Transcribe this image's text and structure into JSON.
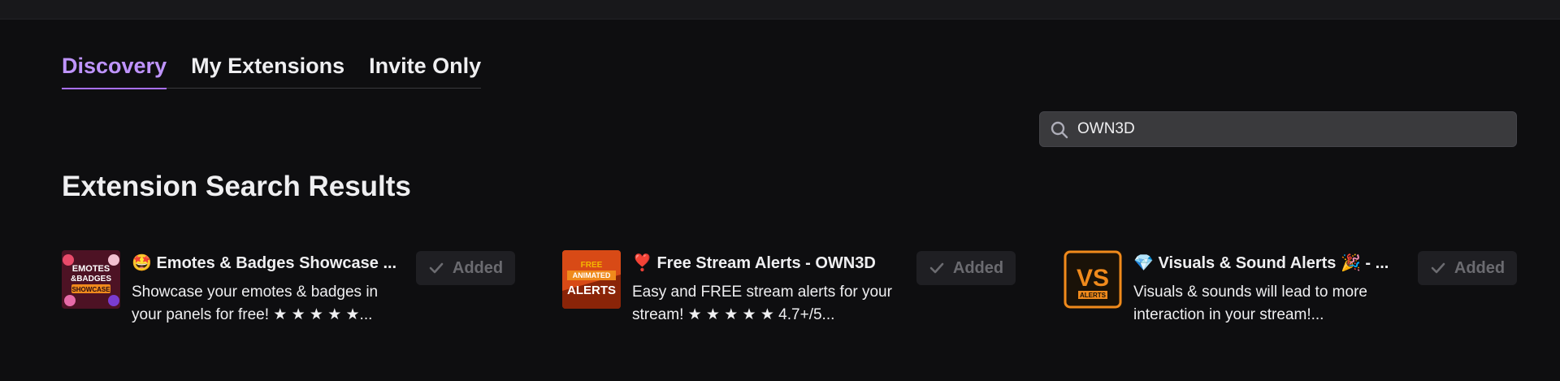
{
  "tabs": [
    {
      "label": "Discovery",
      "active": true
    },
    {
      "label": "My Extensions",
      "active": false
    },
    {
      "label": "Invite Only",
      "active": false
    }
  ],
  "search": {
    "value": "OWN3D",
    "icon": "search-icon"
  },
  "heading": "Extension Search Results",
  "results": [
    {
      "title": "🤩 Emotes & Badges Showcase ...",
      "description": "Showcase your emotes & badges in your panels for free! ★ ★ ★ ★ ★...",
      "button_label": "Added",
      "thumbnail_text": [
        "EMOTES",
        "&BADGES",
        "SHOWCASE"
      ]
    },
    {
      "title": "❣️ Free Stream Alerts - OWN3D",
      "description": "Easy and FREE stream alerts for your stream! ★ ★ ★ ★ ★ 4.7+/5...",
      "button_label": "Added",
      "thumbnail_text": [
        "FREE",
        "ANIMATED",
        "ALERTS"
      ]
    },
    {
      "title": "💎 Visuals & Sound Alerts 🎉 - ...",
      "description": "Visuals & sounds will lead to more interaction in your stream!...",
      "button_label": "Added",
      "thumbnail_text": [
        "VS",
        "ALERTS"
      ]
    }
  ],
  "colors": {
    "background": "#0e0e10",
    "accent": "#bf94ff",
    "star": "#f5b800"
  }
}
